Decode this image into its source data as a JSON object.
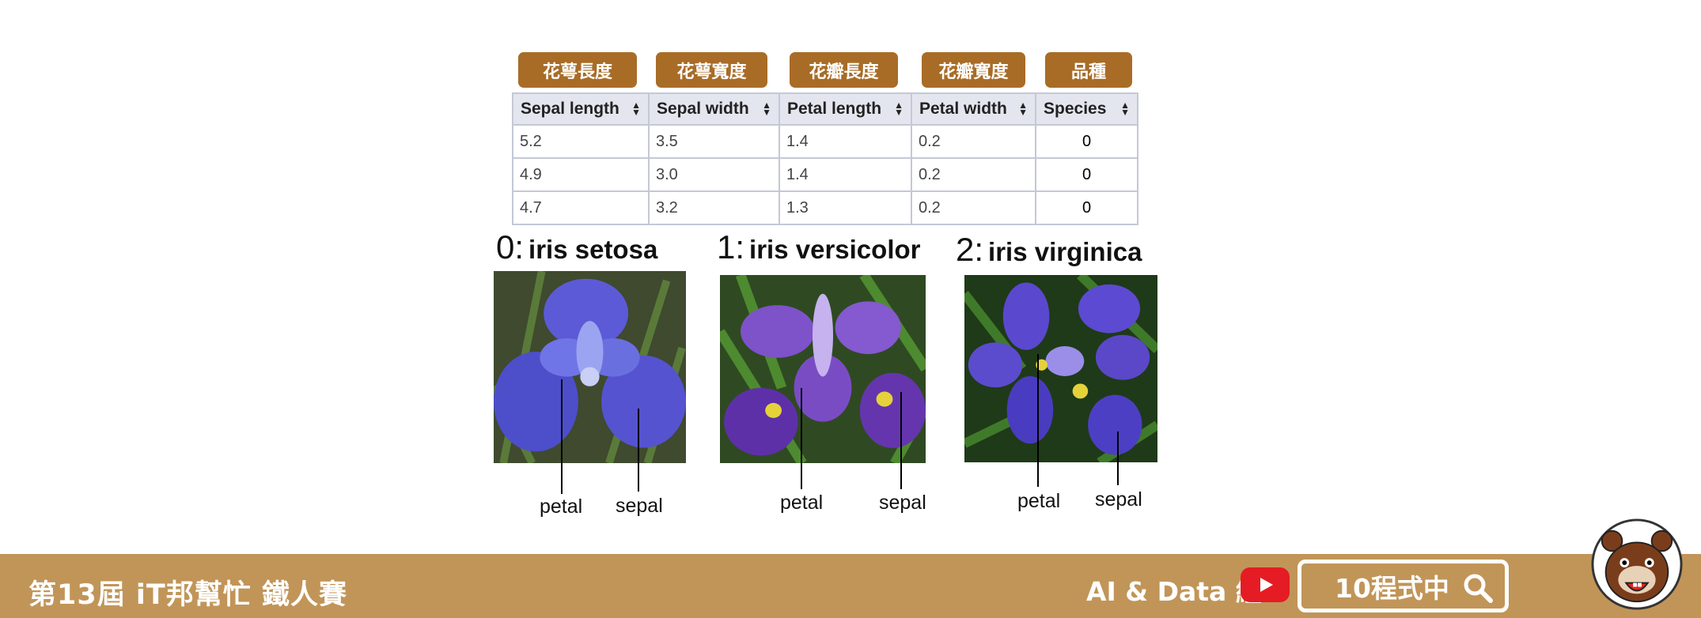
{
  "header_tags": [
    "花萼長度",
    "花萼寬度",
    "花瓣長度",
    "花瓣寬度",
    "品種"
  ],
  "table": {
    "columns": [
      "Sepal length",
      "Sepal width",
      "Petal length",
      "Petal width",
      "Species"
    ],
    "rows": [
      [
        "5.2",
        "3.5",
        "1.4",
        "0.2",
        "0"
      ],
      [
        "4.9",
        "3.0",
        "1.4",
        "0.2",
        "0"
      ],
      [
        "4.7",
        "3.2",
        "1.3",
        "0.2",
        "0"
      ]
    ]
  },
  "species": [
    {
      "num": "0:",
      "name": "iris setosa"
    },
    {
      "num": "1:",
      "name": "iris versicolor"
    },
    {
      "num": "2:",
      "name": "iris virginica"
    }
  ],
  "part_labels": {
    "petal": "petal",
    "sepal": "sepal"
  },
  "footer": {
    "contest_title": "第13屆 iT邦幫忙 鐵人賽",
    "group": "AI & Data 組",
    "search_text": "10程式中"
  },
  "icons": {
    "youtube": "youtube-play-icon",
    "search": "search-icon",
    "mascot": "bear-mascot-icon"
  },
  "colors": {
    "tag_bg": "#a86c27",
    "footer_bg": "#c19558",
    "youtube_red": "#e51c23",
    "table_header_bg": "#e4e6ef"
  }
}
